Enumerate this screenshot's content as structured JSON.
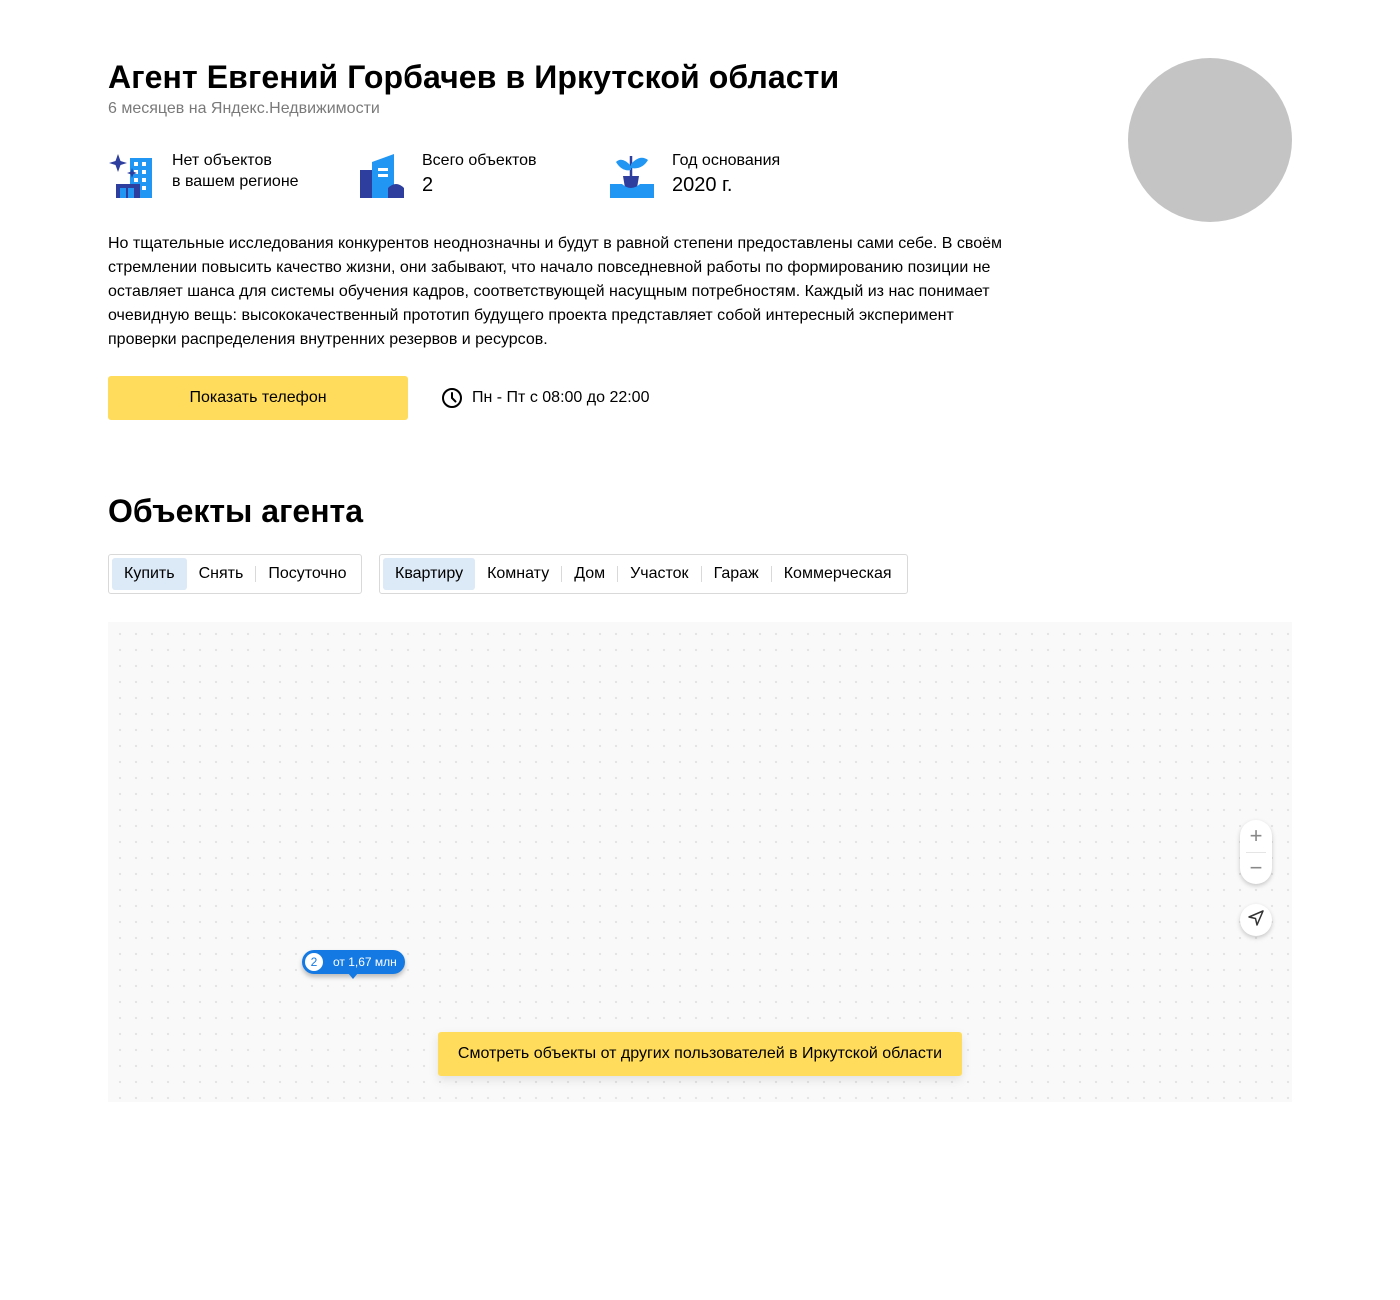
{
  "agent": {
    "title": "Агент Евгений Горбачев в Иркутской области",
    "subtitle": "6 месяцев на Яндекс.Недвижимости"
  },
  "stats": [
    {
      "icon": "buildings-sparkle-icon",
      "line1": "Нет объектов",
      "line2": "в вашем регионе"
    },
    {
      "icon": "building-icon",
      "line1": "Всего объектов",
      "value": "2"
    },
    {
      "icon": "sprout-icon",
      "line1": "Год основания",
      "value": "2020 г."
    }
  ],
  "description": "Но тщательные исследования конкурентов неоднозначны и будут в равной степени предоставлены сами себе. В своём стремлении повысить качество жизни, они забывают, что начало повседневной работы по формированию позиции не оставляет шанса для системы обучения кадров, соответствующей насущным потребностям. Каждый из нас понимает очевидную вещь: высококачественный прототип будущего проекта представляет собой интересный эксперимент проверки распределения внутренних резервов и ресурсов.",
  "contact": {
    "phone_button": "Показать телефон",
    "hours": "Пн - Пт с 08:00 до 22:00"
  },
  "objects": {
    "title": "Объекты агента",
    "deal_types": [
      "Купить",
      "Снять",
      "Посуточно"
    ],
    "deal_active": "Купить",
    "property_types": [
      "Квартиру",
      "Комнату",
      "Дом",
      "Участок",
      "Гараж",
      "Коммерческая"
    ],
    "property_active": "Квартиру"
  },
  "map": {
    "zoom_in": "+",
    "zoom_out": "−",
    "pin_count": "2",
    "pin_price": "от 1,67 млн",
    "others_button": "Смотреть объекты от других пользователей в Иркутской области"
  },
  "colors": {
    "accent_yellow": "#ffdc5c",
    "pin_blue": "#1479e3",
    "active_segment": "#dce9f6",
    "avatar_gray": "#c4c4c4"
  }
}
